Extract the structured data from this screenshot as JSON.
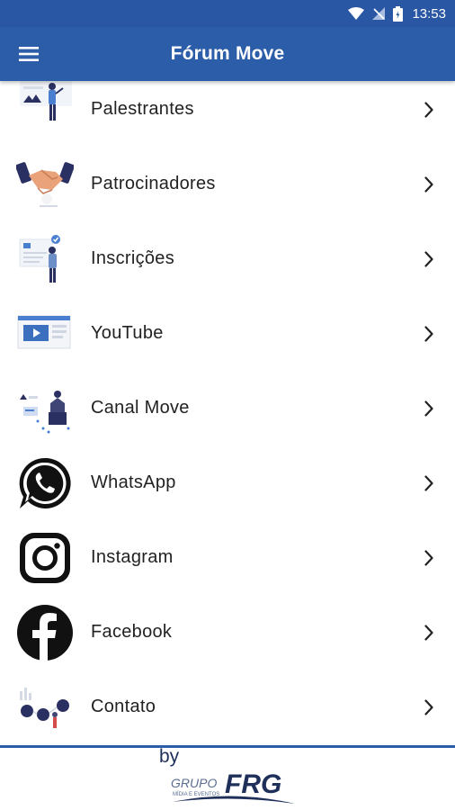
{
  "status_bar": {
    "time": "13:53"
  },
  "app_bar": {
    "title": "Fórum Move"
  },
  "menu": {
    "items": [
      {
        "label": "Palestrantes",
        "icon": "speaker-illustration-icon"
      },
      {
        "label": "Patrocinadores",
        "icon": "handshake-illustration-icon"
      },
      {
        "label": "Inscrições",
        "icon": "registration-illustration-icon"
      },
      {
        "label": "YouTube",
        "icon": "video-player-illustration-icon"
      },
      {
        "label": "Canal Move",
        "icon": "channel-illustration-icon"
      },
      {
        "label": "WhatsApp",
        "icon": "whatsapp-icon"
      },
      {
        "label": "Instagram",
        "icon": "instagram-icon"
      },
      {
        "label": "Facebook",
        "icon": "facebook-icon"
      },
      {
        "label": "Contato",
        "icon": "contact-illustration-icon"
      }
    ]
  },
  "footer": {
    "by_text": "by",
    "logo_group": "GRUPO",
    "logo_brand": "FRG",
    "logo_tagline": "MÍDIA E EVENTOS"
  },
  "colors": {
    "primary": "#2c5da8",
    "status_bar": "#2957a4",
    "accent_navy": "#2a3162",
    "illustration_blue": "#4a7fd0",
    "text": "#222222"
  }
}
